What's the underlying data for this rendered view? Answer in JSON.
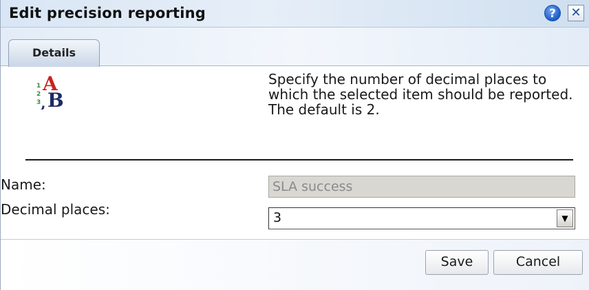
{
  "dialog": {
    "title": "Edit precision reporting",
    "help_label": "?",
    "close_label": "✕"
  },
  "tabs": [
    {
      "label": "Details",
      "selected": true
    }
  ],
  "details": {
    "description": "Specify the number of decimal places to which the selected item should be reported. The default is 2.",
    "name_label": "Name:",
    "name_value": "SLA success",
    "decimal_label": "Decimal places:",
    "decimal_value": "3",
    "logo_icon": "decimal-precision-icon"
  },
  "footer": {
    "save_label": "Save",
    "cancel_label": "Cancel"
  }
}
